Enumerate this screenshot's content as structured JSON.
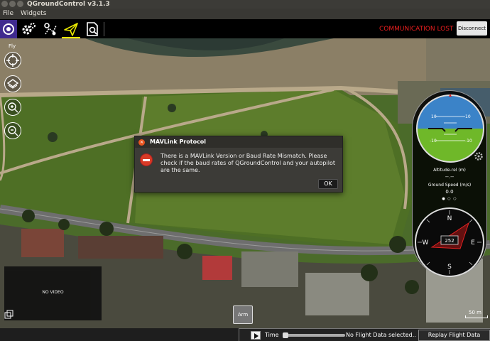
{
  "window": {
    "title": "QGroundControl v3.1.3"
  },
  "menu": {
    "file": "File",
    "widgets": "Widgets"
  },
  "toolbar": {
    "status": "COMMUNICATION LOST",
    "disconnect_label": "Disconnect",
    "active_tool": "fly"
  },
  "map": {
    "mode_label": "Fly",
    "scale_label": "50 m"
  },
  "dialog": {
    "title": "MAVLink Protocol",
    "message": "There is a MAVLink Version or Baud Rate Mismatch. Please check if the baud rates of QGroundControl and your autopilot are the same.",
    "ok_label": "OK"
  },
  "instruments": {
    "altitude_label": "Altitude-rel (m)",
    "altitude_value": "--.--",
    "ground_speed_label": "Ground Speed (m/s)",
    "ground_speed_value": "0.0",
    "heading_value": "252",
    "pitch_ticks": [
      "10",
      "10",
      "-10",
      "-10"
    ],
    "compass": {
      "n": "N",
      "s": "S",
      "e": "E",
      "w": "W"
    }
  },
  "video": {
    "status": "NO VIDEO"
  },
  "arm_label": "Arm",
  "replay": {
    "time_label": "Time",
    "status": "No Flight Data selected..",
    "button_label": "Replay Flight Data"
  },
  "colors": {
    "alert": "#ea1e1e",
    "sky": "#3b83c8",
    "ground": "#6fb829",
    "accent_yellow": "#eaea00"
  }
}
